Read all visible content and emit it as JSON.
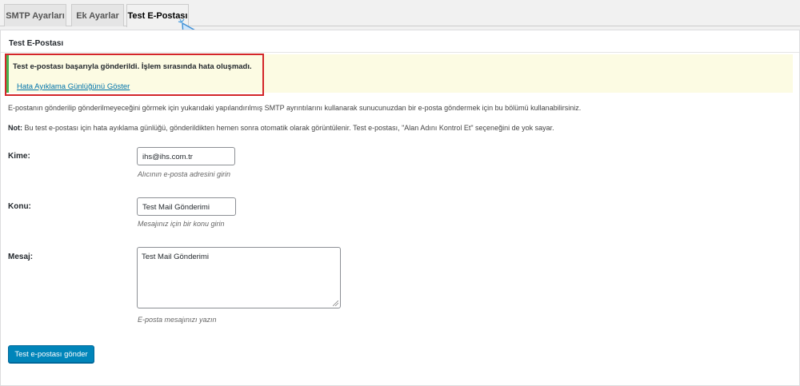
{
  "tabs": [
    {
      "label": "SMTP Ayarları",
      "active": false
    },
    {
      "label": "Ek Ayarlar",
      "active": false
    },
    {
      "label": "Test E-Postası",
      "active": true
    }
  ],
  "panel": {
    "title": "Test E-Postası"
  },
  "notice": {
    "message": "Test e-postası başarıyla gönderildi. İşlem sırasında hata oluşmadı.",
    "link_label": "Hata Ayıklama Günlüğünü Göster"
  },
  "description": {
    "line1": "E-postanın gönderilip gönderilmeyeceğini görmek için yukarıdaki yapılandırılmış SMTP ayrıntılarını kullanarak sunucunuzdan bir e-posta göndermek için bu bölümü kullanabilirsiniz.",
    "note_label": "Not:",
    "note_text": " Bu test e-postası için hata ayıklama günlüğü, gönderildikten hemen sonra otomatik olarak görüntülenir. Test e-postası, \"Alan Adını Kontrol Et\" seçeneğini de yok sayar."
  },
  "form": {
    "to": {
      "label": "Kime:",
      "value": "ihs@ihs.com.tr",
      "hint": "Alıcının e-posta adresini girin"
    },
    "subject": {
      "label": "Konu:",
      "value": "Test Mail Gönderimi",
      "hint": "Mesajınız için bir konu girin"
    },
    "message": {
      "label": "Mesaj:",
      "value": "Test Mail Gönderimi",
      "hint": "E-posta mesajınızı yazın"
    },
    "submit_label": "Test e-postası gönder"
  },
  "colors": {
    "accent": "#0085ba",
    "success_border": "#46b450",
    "highlight": "#d3262a",
    "notice_bg": "#fcfbe3"
  }
}
